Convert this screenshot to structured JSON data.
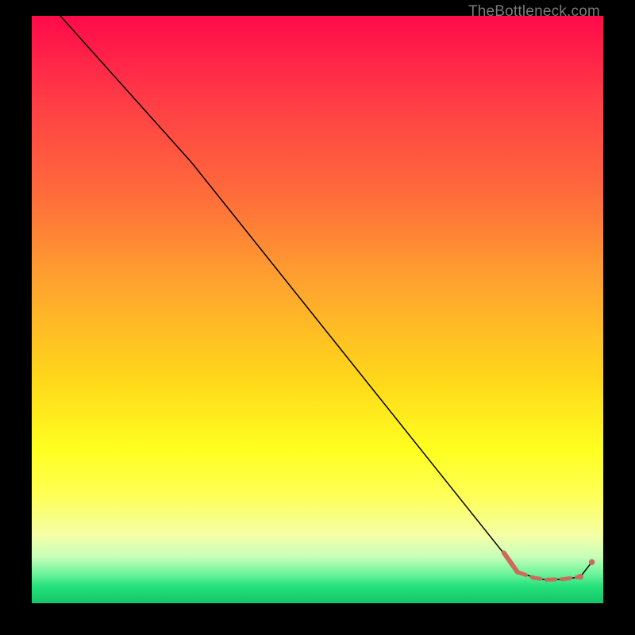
{
  "watermark": "TheBottleneck.com",
  "chart_data": {
    "type": "line",
    "title": "",
    "xlabel": "",
    "ylabel": "",
    "xlim": [
      0,
      100
    ],
    "ylim": [
      0,
      100
    ],
    "grid": false,
    "legend": false,
    "series": [
      {
        "name": "main-curve",
        "style": "solid",
        "color": "#000000",
        "width": 1.5,
        "x": [
          5,
          28,
          83,
          85,
          88,
          90,
          93,
          96,
          98
        ],
        "y": [
          100,
          75,
          8,
          5.5,
          4.3,
          4.0,
          4.1,
          4.5,
          7
        ]
      },
      {
        "name": "tail-highlight-thick",
        "style": "solid",
        "color": "#cc6b5c",
        "width": 6,
        "x": [
          82.6,
          85.0
        ],
        "y": [
          8.6,
          5.3
        ]
      },
      {
        "name": "tail-highlight-dashed",
        "style": "dashed",
        "color": "#cc6b5c",
        "width": 5,
        "x": [
          85.0,
          88.0,
          90.0,
          93.0,
          96.0
        ],
        "y": [
          5.3,
          4.3,
          4.0,
          4.1,
          4.5
        ]
      },
      {
        "name": "tail-end-marker",
        "style": "point",
        "color": "#cc6b5c",
        "radius": 3.8,
        "x": [
          96.0,
          98.0
        ],
        "y": [
          4.5,
          7.0
        ]
      }
    ],
    "gradient_bands_pct_from_top": [
      {
        "color": "#ff0a4a",
        "stop": 0
      },
      {
        "color": "#ff3b46",
        "stop": 14
      },
      {
        "color": "#ff6a3b",
        "stop": 30
      },
      {
        "color": "#ffa52e",
        "stop": 46
      },
      {
        "color": "#ffd81a",
        "stop": 62
      },
      {
        "color": "#ffff20",
        "stop": 74
      },
      {
        "color": "#ffff5a",
        "stop": 82
      },
      {
        "color": "#f4ffa8",
        "stop": 88.5
      },
      {
        "color": "#c9ffb9",
        "stop": 92
      },
      {
        "color": "#6df39b",
        "stop": 95
      },
      {
        "color": "#22e07a",
        "stop": 97.2
      },
      {
        "color": "#17c46a",
        "stop": 100
      }
    ]
  }
}
